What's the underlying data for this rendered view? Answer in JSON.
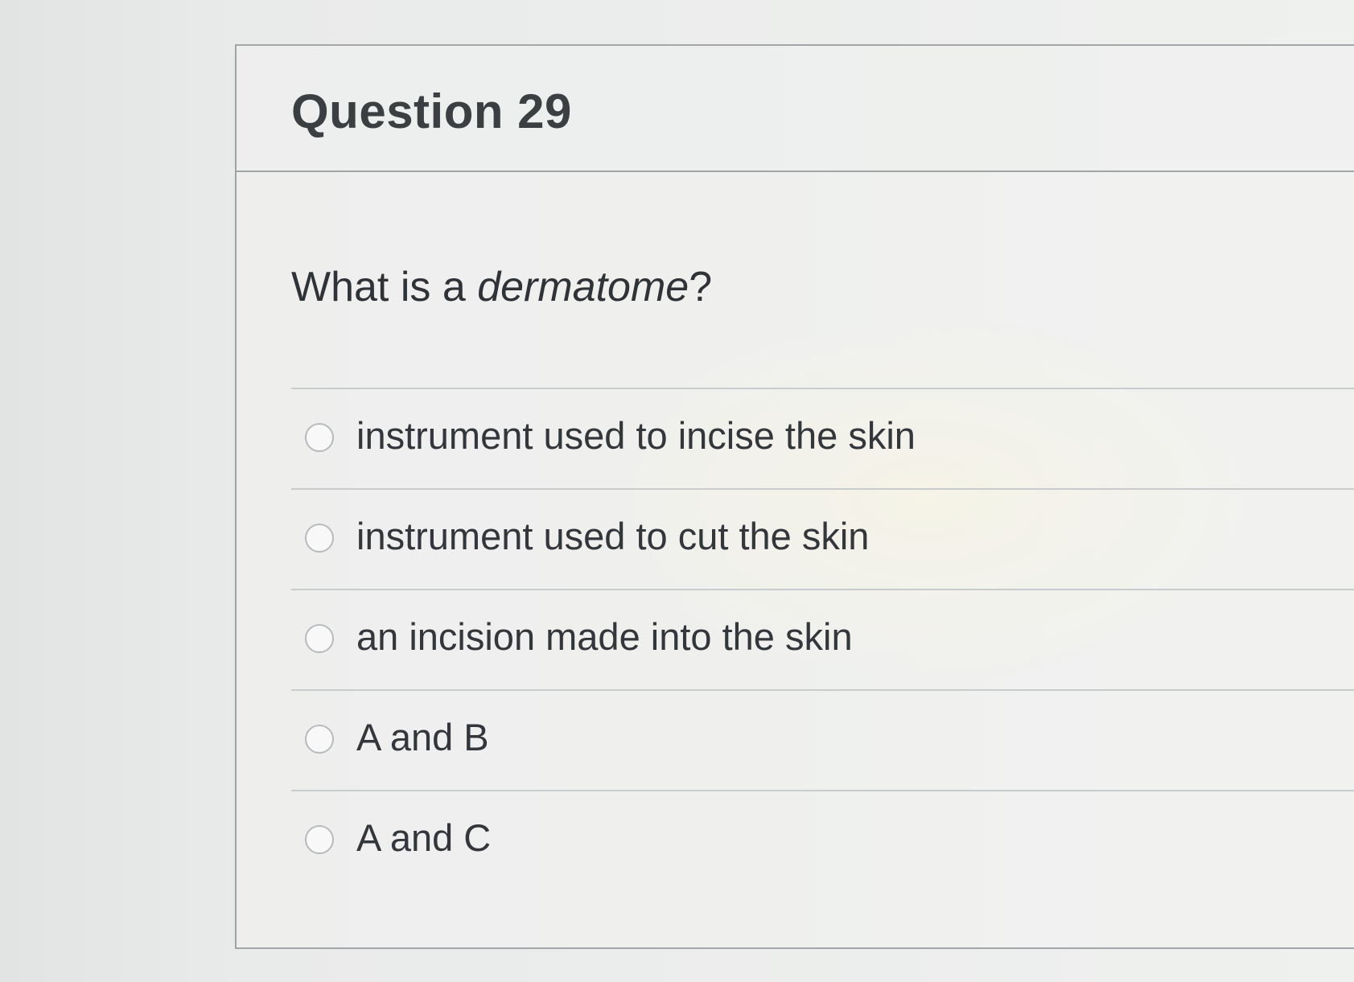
{
  "question": {
    "title": "Question 29",
    "prompt_prefix": "What is a ",
    "prompt_emphasis": "dermatome",
    "prompt_suffix": "?"
  },
  "answers": [
    {
      "label": "instrument used to incise the skin",
      "selected": false
    },
    {
      "label": "instrument used to cut the skin",
      "selected": false
    },
    {
      "label": "an incision made into the skin",
      "selected": false
    },
    {
      "label": "A and B",
      "selected": false
    },
    {
      "label": "A and C",
      "selected": false
    }
  ]
}
